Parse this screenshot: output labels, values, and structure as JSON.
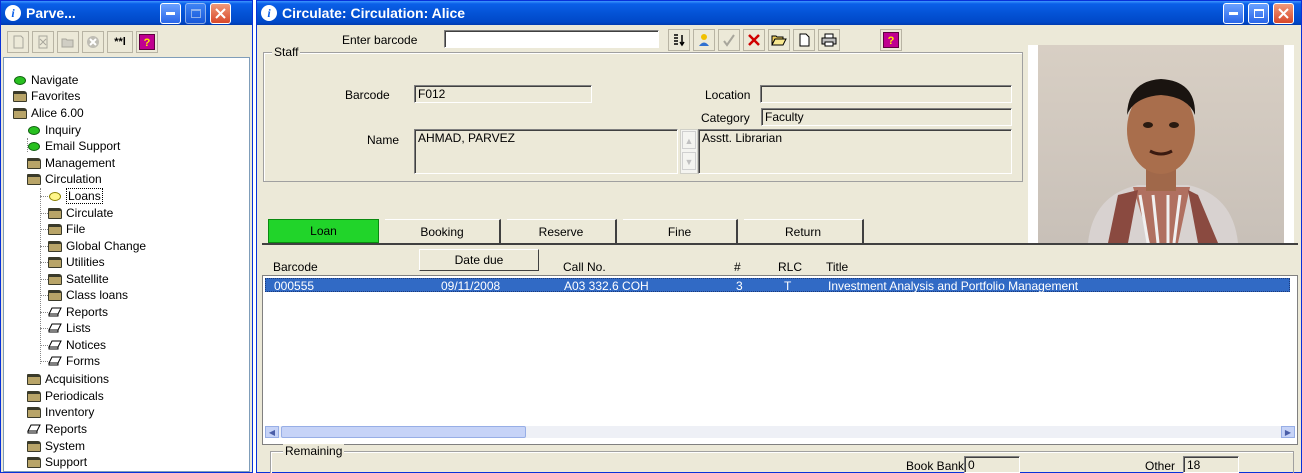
{
  "left_window": {
    "title": "Parve...",
    "toolbar_icons": [
      "new-icon",
      "delete-icon",
      "open-icon",
      "stop-icon",
      "wildcard-icon",
      "help-icon"
    ],
    "wildcard_label": "**l",
    "help_label": "?",
    "tree": {
      "navigate": "Navigate",
      "favorites": "Favorites",
      "alice": "Alice 6.00",
      "inquiry": "Inquiry",
      "email_support": "Email Support",
      "management": "Management",
      "circulation": "Circulation",
      "loans": "Loans",
      "circulate": "Circulate",
      "file": "File",
      "global_change": "Global Change",
      "utilities": "Utilities",
      "satellite": "Satellite",
      "class_loans": "Class loans",
      "reports_sub": "Reports",
      "lists": "Lists",
      "notices": "Notices",
      "forms": "Forms",
      "acquisitions": "Acquisitions",
      "periodicals": "Periodicals",
      "inventory": "Inventory",
      "reports": "Reports",
      "system": "System",
      "support": "Support"
    }
  },
  "main_window": {
    "title": "Circulate: Circulation: Alice",
    "barcode_prompt": "Enter barcode",
    "barcode_value": "",
    "help_label": "?",
    "staff": {
      "group_title": "Staff",
      "barcode_label": "Barcode",
      "barcode_value": "F012",
      "location_label": "Location",
      "location_value": "",
      "category_label": "Category",
      "category_value": "Faculty",
      "name_label": "Name",
      "name_value": "AHMAD, PARVEZ",
      "designation_value": "Asstt. Librarian"
    },
    "tabs": [
      "Loan",
      "Booking",
      "Reserve",
      "Fine",
      "Return"
    ],
    "active_tab": "Loan",
    "list": {
      "columns": {
        "barcode": "Barcode",
        "date_due": "Date due",
        "call_no": "Call No.",
        "count": "#",
        "rlc": "RLC",
        "title": "Title"
      },
      "rows": [
        {
          "barcode": "000555",
          "date_due": "09/11/2008",
          "call_no": "A03 332.6 COH",
          "count": "3",
          "rlc": "T",
          "title": "Investment Analysis and Portfolio Management"
        }
      ]
    },
    "remaining": {
      "group_title": "Remaining",
      "book_bank_label": "Book Bank",
      "book_bank_value": "0",
      "other_label": "Other",
      "other_value": "18"
    }
  },
  "colors": {
    "titlebar": "#0453d6",
    "window_bg": "#ece9d8",
    "active_tab": "#21d42a",
    "selection": "#316ac5"
  }
}
